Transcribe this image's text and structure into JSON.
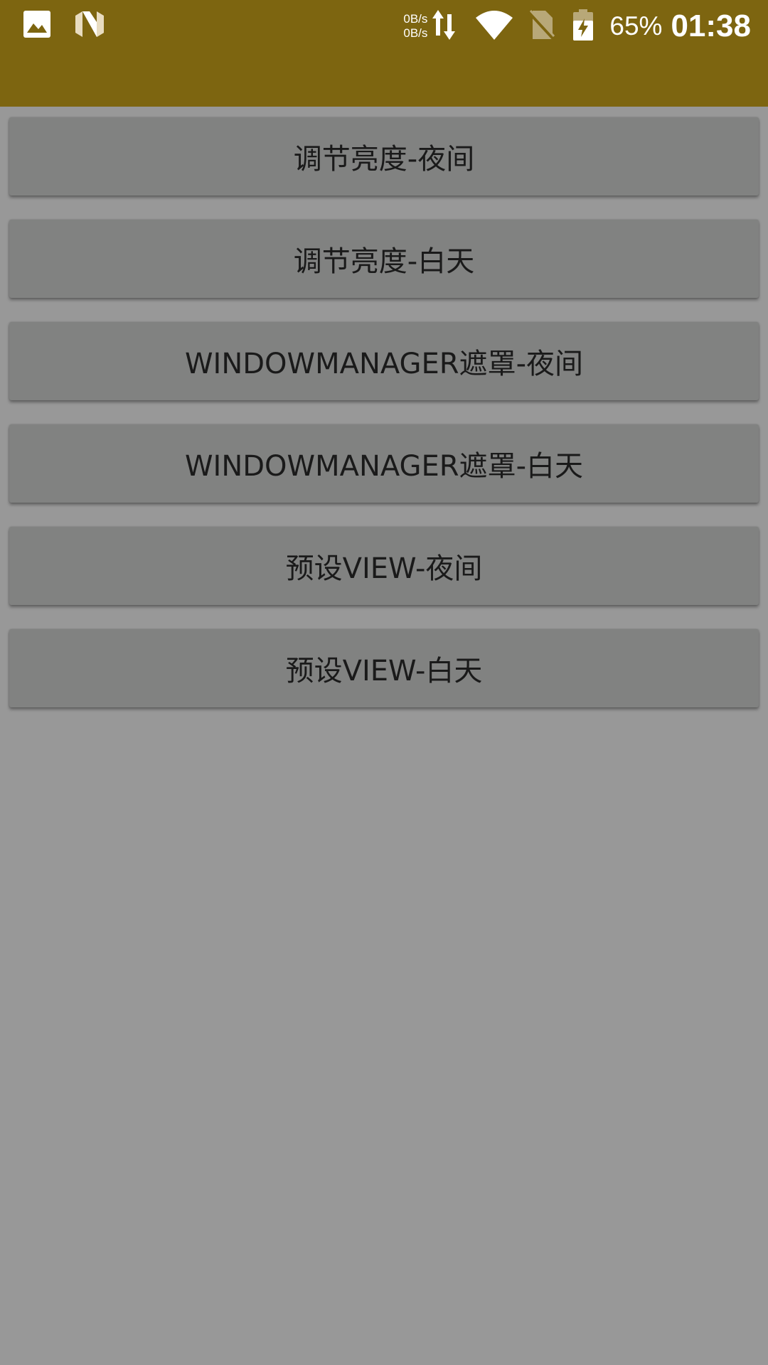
{
  "status_bar": {
    "net_speed_up": "0B/s",
    "net_speed_down": "0B/s",
    "battery_percent": "65%",
    "time": "01:38",
    "icons": [
      "image-icon",
      "n-logo-icon",
      "data-transfer-icon",
      "wifi-icon",
      "no-sim-icon",
      "battery-charging-icon"
    ],
    "background_color": "#7d6510"
  },
  "buttons": [
    {
      "label": "调节亮度-夜间"
    },
    {
      "label": "调节亮度-白天"
    },
    {
      "label": "WINDOWMANAGER遮罩-夜间"
    },
    {
      "label": "WINDOWMANAGER遮罩-白天"
    },
    {
      "label": "预设VIEW-夜间"
    },
    {
      "label": "预设VIEW-白天"
    }
  ],
  "colors": {
    "page_background": "#989898",
    "button_background": "#818281",
    "button_text": "#1a1a1a"
  }
}
